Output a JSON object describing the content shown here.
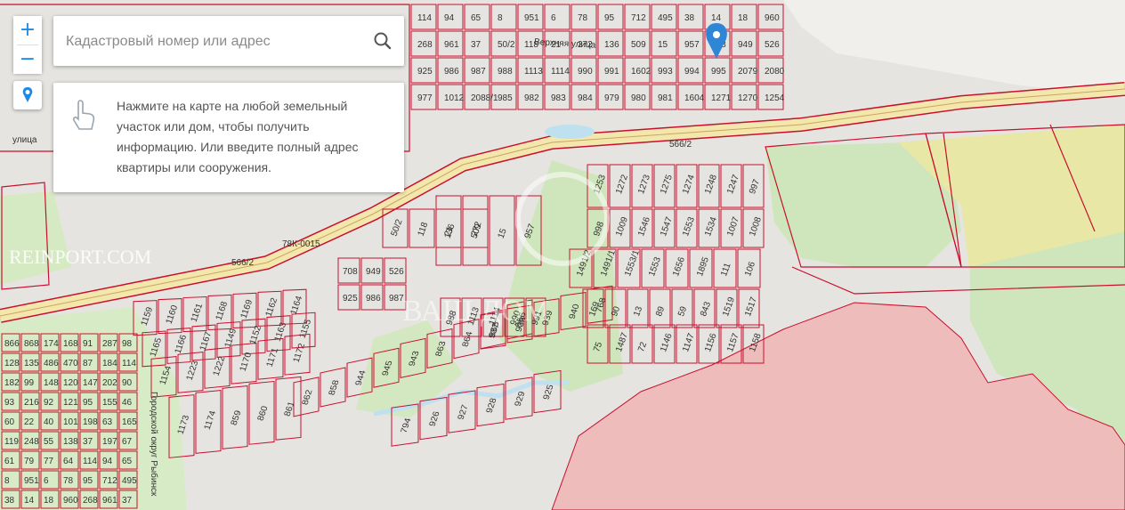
{
  "search": {
    "placeholder": "Кадастровый номер или адрес"
  },
  "hint": {
    "text": "Нажмите на карте на любой земельный участок или дом, чтобы получить информацию. Или введите полный адрес квартиры или сооружения."
  },
  "zoom": {
    "in_label": "+",
    "out_label": "−"
  },
  "watermarks": {
    "left": "REINPORT.COM",
    "center": "ВАШ ДОМ"
  },
  "map": {
    "street_labels": [
      "Верхняя улица",
      "улица",
      "Городской округ Рыбинск"
    ],
    "road_labels": [
      "566/2",
      "566/2",
      "78К-0015"
    ],
    "colors": {
      "parcel_line": "#c8102e",
      "road_fill": "#f1e4a8",
      "forest": "#c9e3b4",
      "pink_area": "#efbcbc",
      "field": "#e8e6a4"
    },
    "parcels": [
      "114",
      "94",
      "65",
      "8",
      "951",
      "6",
      "78",
      "95",
      "712",
      "495",
      "38",
      "14",
      "18",
      "960",
      "268",
      "961",
      "37",
      "50/2",
      "118",
      "21",
      "272",
      "136",
      "509",
      "15",
      "957",
      "708",
      "949",
      "526",
      "925",
      "986",
      "987",
      "988",
      "1113",
      "1114",
      "990",
      "991",
      "1602",
      "993",
      "994",
      "995",
      "2079",
      "2080",
      "977",
      "1012",
      "2088/1",
      "985",
      "982",
      "983",
      "984",
      "979",
      "980",
      "981",
      "1604",
      "1271",
      "1270",
      "1254",
      "1253",
      "1272",
      "1273",
      "1275",
      "1274",
      "1248",
      "1247",
      "997",
      "998",
      "1009",
      "1546",
      "1547",
      "1553",
      "1534",
      "1007",
      "1008",
      "1491/2",
      "1491/1",
      "1553/1",
      "1553",
      "1656",
      "1895",
      "111",
      "106",
      "169",
      "90",
      "13",
      "89",
      "59",
      "843",
      "1519",
      "1517",
      "75",
      "1487",
      "72",
      "1146",
      "1147",
      "1156",
      "1157",
      "1158",
      "1159",
      "1160",
      "1161",
      "1168",
      "1169",
      "1162",
      "1164",
      "1165",
      "1166",
      "1167",
      "1149",
      "1152",
      "1163",
      "1155",
      "1154",
      "1223",
      "1222",
      "1170",
      "1171",
      "1172",
      "1173",
      "1174",
      "859",
      "860",
      "861",
      "862",
      "858",
      "944",
      "945",
      "943",
      "863",
      "864",
      "865",
      "866",
      "937",
      "938",
      "939",
      "940",
      "768",
      "794",
      "926",
      "927",
      "928",
      "929",
      "925",
      "866",
      "868",
      "174",
      "168",
      "91",
      "287",
      "98",
      "128",
      "135",
      "486",
      "470",
      "87",
      "184",
      "114",
      "182",
      "99",
      "148",
      "120",
      "147",
      "202",
      "90",
      "93",
      "216",
      "92",
      "121",
      "95",
      "155",
      "46",
      "60",
      "22",
      "40",
      "101",
      "198",
      "63",
      "165",
      "119",
      "248",
      "55",
      "138",
      "37",
      "197",
      "67",
      "61",
      "79",
      "77",
      "64"
    ]
  }
}
